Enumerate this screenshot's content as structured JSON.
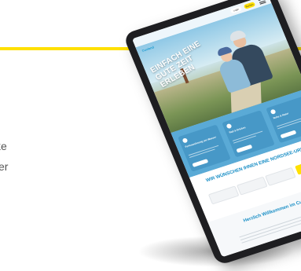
{
  "page": {
    "accent_color": "#ffe000",
    "side_text_lines": [
      "ke",
      "er"
    ]
  },
  "tablet": {
    "site": {
      "logo": "Cuxland",
      "nav": [
        "Login",
        "Buchen"
      ],
      "hero_title": "Einfach eine gute Zeit erleben",
      "cards": [
        {
          "title": "Ferienwohnung am Wasser",
          "icon": "bike-icon"
        },
        {
          "title": "Rad & Erleben",
          "icon": "pin-icon"
        },
        {
          "title": "Ruhe & Natur",
          "icon": "leaf-icon"
        }
      ],
      "booking_title": "Wir wünschen ihnen eine Nordsee-Urlaub!",
      "welcome_title": "Herzlich Willkommen im Cuxland",
      "colors": {
        "primary": "#1a8fc6",
        "cards_bg": "#5aaad6",
        "button": "#ffe000"
      }
    }
  }
}
